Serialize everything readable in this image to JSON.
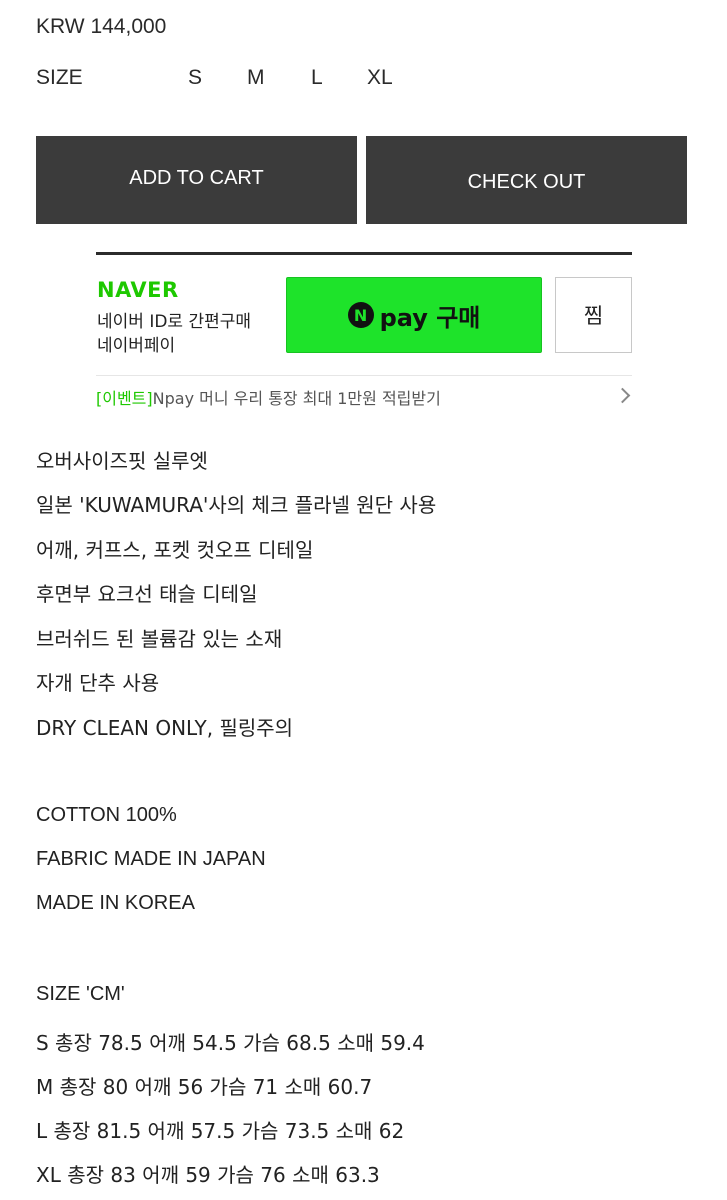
{
  "product": {
    "price": "KRW 144,000",
    "size_label": "SIZE",
    "sizes": [
      "S",
      "M",
      "L",
      "XL"
    ]
  },
  "actions": {
    "add_to_cart": "ADD TO CART",
    "check_out": "CHECK OUT"
  },
  "naver": {
    "brand": "NAVER",
    "line1": "네이버 ID로 간편구매",
    "line2": "네이버페이",
    "npay_symbol": "N",
    "npay_label": "pay 구매",
    "zzim_label": "찜",
    "event_tag": "[이벤트]",
    "event_text": "Npay 머니 우리 통장 최대 1만원 적립받기"
  },
  "description": {
    "features": [
      "오버사이즈핏 실루엣",
      "일본 'KUWAMURA'사의 체크 플라넬 원단 사용",
      "어깨, 커프스, 포켓 컷오프 디테일",
      "후면부 요크선 태슬 디테일",
      "브러쉬드 된 볼륨감 있는 소재",
      "자개 단추 사용",
      "DRY CLEAN ONLY, 필링주의"
    ],
    "materials": [
      "COTTON 100%",
      "FABRIC MADE IN JAPAN",
      "MADE IN KOREA"
    ],
    "size_title": "SIZE 'CM'",
    "size_rows": [
      "S 총장 78.5 어깨 54.5 가슴 68.5 소매 59.4",
      "M 총장 80 어깨 56 가슴 71 소매 60.7",
      "L 총장 81.5 어깨 57.5 가슴 73.5 소매 62",
      "XL 총장 83 어깨 59 가슴 76 소매 63.3"
    ]
  },
  "colors": {
    "button_bg": "#3b3b3b",
    "naver_green": "#1ec800",
    "npay_green": "#1ee32a"
  }
}
